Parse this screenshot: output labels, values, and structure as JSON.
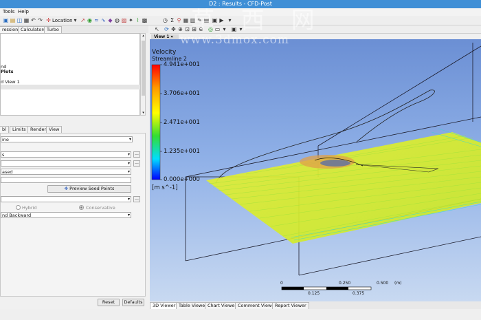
{
  "window": {
    "title": "D2 : Results - CFD-Post"
  },
  "menu": {
    "items": [
      "Tools",
      "Help"
    ]
  },
  "toolbar": {
    "location_label": "Location"
  },
  "left_tabs": [
    "ressions",
    "Calculators",
    "Turbo"
  ],
  "tree": {
    "items": [
      "nd",
      "Plots",
      "d View 1"
    ]
  },
  "detail_tabs": [
    "bl",
    "Limits",
    "Render",
    "View"
  ],
  "details": {
    "field1": "ine",
    "field2": "s",
    "field3": "",
    "field4": "ased",
    "field5": "",
    "preview_seed_points": "Preview Seed Points",
    "field6": "",
    "radio_hybrid": "Hybrid",
    "radio_conservative": "Conservative",
    "direction": "nd Backward",
    "mini_btn": "..."
  },
  "buttons": {
    "reset": "Reset",
    "defaults": "Defaults"
  },
  "viewport": {
    "view_label": "View 1",
    "legend": {
      "title": "Velocity",
      "subtitle": "Streamline 2",
      "ticks": [
        "4.941e+001",
        "3.706e+001",
        "2.471e+001",
        "1.235e+001",
        "0.000e+000"
      ],
      "unit": "[m s^-1]",
      "colors": [
        "#ff0000",
        "#ff9900",
        "#ffff00",
        "#33dd33",
        "#00ddff",
        "#0000ff"
      ]
    },
    "scale": {
      "top_labels": [
        "0",
        "0.250",
        "0.500"
      ],
      "unit": "(m)",
      "bottom_labels": [
        "0.125",
        "0.375"
      ]
    }
  },
  "bottom_tabs": [
    "3D Viewer",
    "Table Viewer",
    "Chart Viewer",
    "Comment Viewer",
    "Report Viewer"
  ],
  "watermark": {
    "chinese": "草 西 网",
    "url": "www.3dmox.com"
  }
}
